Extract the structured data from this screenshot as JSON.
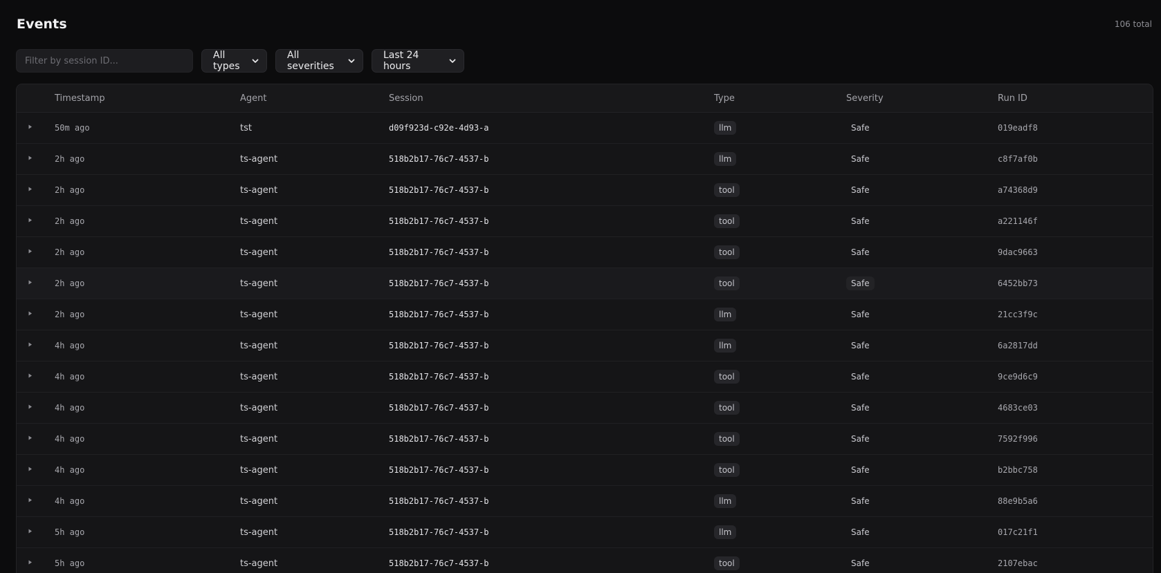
{
  "header": {
    "title": "Events",
    "total": "106 total"
  },
  "filters": {
    "search_placeholder": "Filter by session ID...",
    "type_select": "All types",
    "severity_select": "All severities",
    "time_select": "Last 24 hours"
  },
  "table": {
    "columns": [
      "Timestamp",
      "Agent",
      "Session",
      "Type",
      "Severity",
      "Run ID"
    ],
    "rows": [
      {
        "timestamp": "50m ago",
        "agent": "tst",
        "session": "d09f923d-c92e-4d93-a",
        "type": "llm",
        "severity": "Safe",
        "run_id": "019eadf8"
      },
      {
        "timestamp": "2h ago",
        "agent": "ts-agent",
        "session": "518b2b17-76c7-4537-b",
        "type": "llm",
        "severity": "Safe",
        "run_id": "c8f7af0b"
      },
      {
        "timestamp": "2h ago",
        "agent": "ts-agent",
        "session": "518b2b17-76c7-4537-b",
        "type": "tool",
        "severity": "Safe",
        "run_id": "a74368d9"
      },
      {
        "timestamp": "2h ago",
        "agent": "ts-agent",
        "session": "518b2b17-76c7-4537-b",
        "type": "tool",
        "severity": "Safe",
        "run_id": "a221146f"
      },
      {
        "timestamp": "2h ago",
        "agent": "ts-agent",
        "session": "518b2b17-76c7-4537-b",
        "type": "tool",
        "severity": "Safe",
        "run_id": "9dac9663"
      },
      {
        "timestamp": "2h ago",
        "agent": "ts-agent",
        "session": "518b2b17-76c7-4537-b",
        "type": "tool",
        "severity": "Safe",
        "run_id": "6452bb73"
      },
      {
        "timestamp": "2h ago",
        "agent": "ts-agent",
        "session": "518b2b17-76c7-4537-b",
        "type": "llm",
        "severity": "Safe",
        "run_id": "21cc3f9c"
      },
      {
        "timestamp": "4h ago",
        "agent": "ts-agent",
        "session": "518b2b17-76c7-4537-b",
        "type": "llm",
        "severity": "Safe",
        "run_id": "6a2817dd"
      },
      {
        "timestamp": "4h ago",
        "agent": "ts-agent",
        "session": "518b2b17-76c7-4537-b",
        "type": "tool",
        "severity": "Safe",
        "run_id": "9ce9d6c9"
      },
      {
        "timestamp": "4h ago",
        "agent": "ts-agent",
        "session": "518b2b17-76c7-4537-b",
        "type": "tool",
        "severity": "Safe",
        "run_id": "4683ce03"
      },
      {
        "timestamp": "4h ago",
        "agent": "ts-agent",
        "session": "518b2b17-76c7-4537-b",
        "type": "tool",
        "severity": "Safe",
        "run_id": "7592f996"
      },
      {
        "timestamp": "4h ago",
        "agent": "ts-agent",
        "session": "518b2b17-76c7-4537-b",
        "type": "tool",
        "severity": "Safe",
        "run_id": "b2bbc758"
      },
      {
        "timestamp": "4h ago",
        "agent": "ts-agent",
        "session": "518b2b17-76c7-4537-b",
        "type": "llm",
        "severity": "Safe",
        "run_id": "88e9b5a6"
      },
      {
        "timestamp": "5h ago",
        "agent": "ts-agent",
        "session": "518b2b17-76c7-4537-b",
        "type": "llm",
        "severity": "Safe",
        "run_id": "017c21f1"
      },
      {
        "timestamp": "5h ago",
        "agent": "ts-agent",
        "session": "518b2b17-76c7-4537-b",
        "type": "tool",
        "severity": "Safe",
        "run_id": "2107ebac"
      }
    ]
  },
  "icons": {
    "expand": "caret-right-icon",
    "select": "chevron-down-icon"
  },
  "colors": {
    "background": "#0c0c0d",
    "panel": "#151517",
    "badge": "#26262a"
  }
}
